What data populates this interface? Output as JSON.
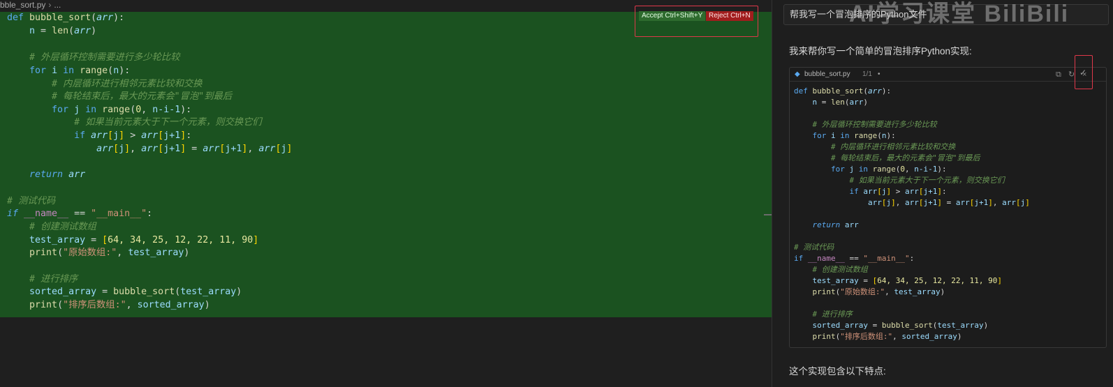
{
  "breadcrumb": {
    "file": "bble_sort.py",
    "trail": "..."
  },
  "diff_actions": {
    "accept": "Accept Ctrl+Shift+Y",
    "reject": "Reject Ctrl+N"
  },
  "code": {
    "def": "def",
    "fname": "bubble_sort",
    "param": "arr",
    "n": "n",
    "len": "len",
    "c1": "# 外层循环控制需要进行多少轮比较",
    "for": "for",
    "i": "i",
    "in": "in",
    "range": "range",
    "c2": "# 内层循环进行相邻元素比较和交换",
    "c3": "# 每轮结束后，最大的元素会\"冒泡\"到最后",
    "j": "j",
    "zero": "0",
    "ni1": "n-i-1",
    "c4": "# 如果当前元素大于下一个元素，则交换它们",
    "if": "if",
    "j1": "j+1",
    "one": "1",
    "return": "return",
    "c5": "# 测试代码",
    "name": "__name__",
    "main": "\"__main__\"",
    "c6": "# 创建测试数组",
    "test_array": "test_array",
    "nums": "64, 34, 25, 12, 22, 11, 90",
    "print": "print",
    "s1": "\"原始数组:\"",
    "c7": "# 进行排序",
    "sorted_array": "sorted_array",
    "s2": "\"排序后数组:\""
  },
  "chat": {
    "user_message": "帮我写一个冒泡排序的Python文件",
    "watermark": "AI学习课堂 BiliBili",
    "reply_intro": "我来帮你写一个简单的冒泡排序Python实现:",
    "snippet_file": "bubble_sort.py",
    "snippet_count": "1/1",
    "snippet_dot": "•",
    "reply_outro": "这个实现包含以下特点:"
  },
  "icons": {
    "file": "diamond-icon",
    "copy": "copy-icon",
    "refresh": "refresh-icon",
    "close": "close-icon",
    "check": "check-icon"
  },
  "colors": {
    "diff_added_bg": "#1b5220",
    "accept": "#2e6b2e",
    "reject": "#a11d1d",
    "highlight_box": "#e0384a"
  }
}
